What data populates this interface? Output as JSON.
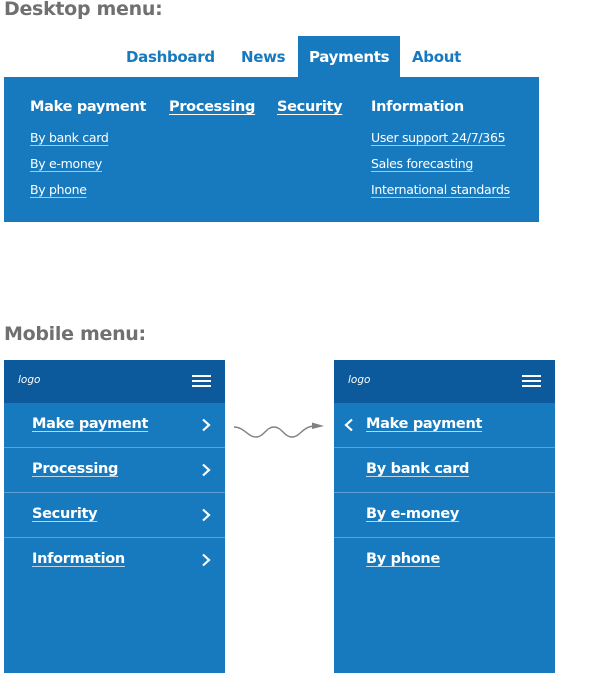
{
  "desktop": {
    "section_title": "Desktop menu:",
    "tabs": [
      {
        "label": "Dashboard",
        "active": false
      },
      {
        "label": "News",
        "active": false
      },
      {
        "label": "Payments",
        "active": true
      },
      {
        "label": "About",
        "active": false
      }
    ],
    "mega_menu": {
      "columns": [
        {
          "heading": "Make payment",
          "heading_is_link": false,
          "links": [
            "By bank card",
            "By e-money",
            "By phone"
          ]
        },
        {
          "heading": "Processing",
          "heading_is_link": true,
          "links": []
        },
        {
          "heading": "Security",
          "heading_is_link": true,
          "links": []
        },
        {
          "heading": "Information",
          "heading_is_link": false,
          "links": [
            "User support 24/7/365",
            "Sales forecasting",
            "International standards"
          ]
        }
      ]
    }
  },
  "mobile": {
    "section_title": "Mobile menu:",
    "left_screen": {
      "logo": "logo",
      "menu_icon": "hamburger-icon",
      "items": [
        {
          "label": "Make payment",
          "icon": "chevron-right-icon"
        },
        {
          "label": "Processing",
          "icon": "chevron-right-icon"
        },
        {
          "label": "Security",
          "icon": "chevron-right-icon"
        },
        {
          "label": "Information",
          "icon": "chevron-right-icon"
        }
      ]
    },
    "transition_icon": "wavy-arrow-icon",
    "right_screen": {
      "logo": "logo",
      "menu_icon": "hamburger-icon",
      "back_item": {
        "label": "Make payment",
        "icon": "chevron-left-icon"
      },
      "items": [
        {
          "label": "By bank card"
        },
        {
          "label": "By e-money"
        },
        {
          "label": "By phone"
        }
      ]
    }
  },
  "colors": {
    "brand_blue": "#1779be",
    "header_dark_blue": "#0c5a9b",
    "title_gray": "#707070",
    "divider": "#5fa0d4"
  }
}
